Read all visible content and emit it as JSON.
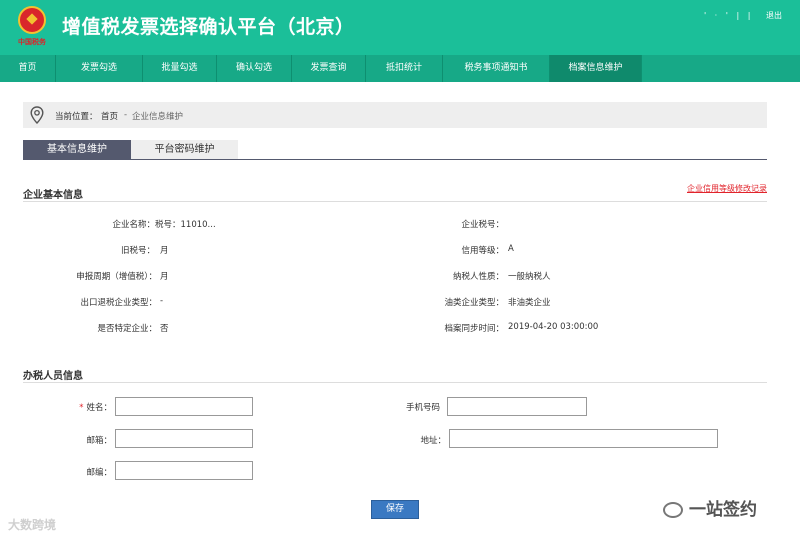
{
  "header": {
    "logo_text": "中国税务",
    "title": "增值税发票选择确认平台（北京）",
    "user_info": "' · ' |  |",
    "logout": "退出"
  },
  "nav": {
    "items": [
      "首页",
      "发票勾选",
      "批量勾选",
      "确认勾选",
      "发票查询",
      "抵扣统计",
      "税务事项通知书",
      "档案信息维护"
    ],
    "active": "档案信息维护"
  },
  "breadcrumb": {
    "label": "当前位置：",
    "home": "首页",
    "sep": "-",
    "current": "企业信息维护"
  },
  "tabs": {
    "basic": "基本信息维护",
    "password": "平台密码维护"
  },
  "company": {
    "section_title": "企业基本信息",
    "credit_link": "企业信用等级修改记录",
    "name_label": "企业名称：",
    "name_value": "税号：11010...",
    "tax_no_label": "企业税号：",
    "tax_no_value": "",
    "old_tax_no_label": "旧税号：",
    "old_tax_no_value": "月",
    "credit_label": "信用等级：",
    "credit_value": "A",
    "period_label": "申报周期（增值税）：",
    "period_value": "月",
    "taxpayer_label": "纳税人性质：",
    "taxpayer_value": "一般纳税人",
    "export_label": "出口退税企业类型：",
    "export_value": "-",
    "oil_label": "油类企业类型：",
    "oil_value": "非油类企业",
    "special_label": "是否特定企业：",
    "special_value": "否",
    "sync_label": "档案同步时间：",
    "sync_value": "2019-04-20 03:00:00"
  },
  "staff": {
    "section_title": "办税人员信息",
    "required_mark": "*",
    "name_label": "姓名：",
    "name_value": "",
    "phone_label": "手机号码",
    "phone_value": "",
    "email_label": "邮箱：",
    "email_value": "",
    "address_label": "地址：",
    "address_value": "",
    "zip_label": "邮编：",
    "zip_value": ""
  },
  "save_label": "保存",
  "watermarks": {
    "left": "大数跨境",
    "right": "一站签约"
  },
  "colors": {
    "header_bg": "#1bbf99",
    "nav_bg": "#17a987",
    "tab_active": "#54596e",
    "link_red": "#e1232b",
    "save_btn": "#3a79c2"
  }
}
